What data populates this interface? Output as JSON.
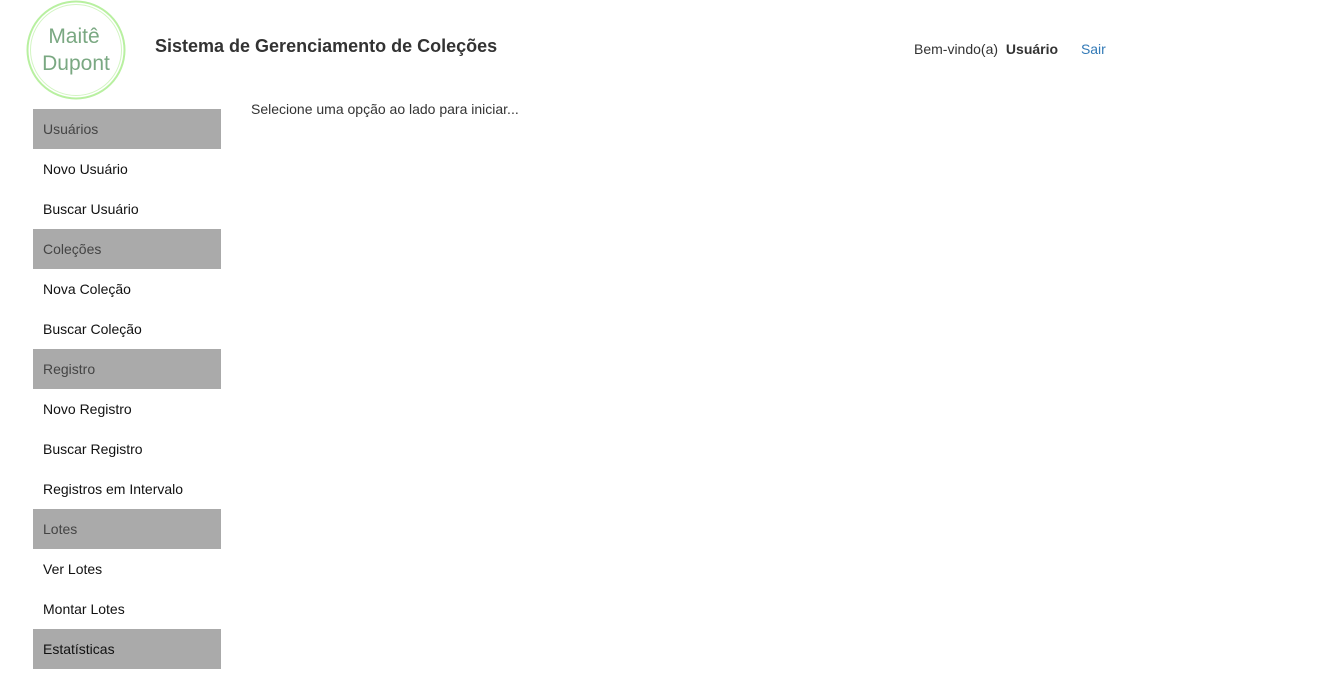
{
  "logo": {
    "line1": "Maitê",
    "line2": "Dupont",
    "ring_color": "#b8f0a0",
    "text_color": "#7aa882"
  },
  "header": {
    "title": "Sistema de Gerenciamento de Coleções",
    "welcome": "Bem-vindo(a)",
    "username": "Usuário",
    "logout": "Sair"
  },
  "sidebar": {
    "users": {
      "header": "Usuários",
      "new": "Novo Usuário",
      "search": "Buscar Usuário"
    },
    "collections": {
      "header": "Coleções",
      "new": "Nova Coleção",
      "search": "Buscar Coleção"
    },
    "records": {
      "header": "Registro",
      "new": "Novo Registro",
      "search": "Buscar Registro",
      "interval": "Registros em Intervalo"
    },
    "batches": {
      "header": "Lotes",
      "view": "Ver Lotes",
      "assemble": "Montar Lotes"
    },
    "stats": {
      "header": "Estatísticas"
    }
  },
  "main": {
    "message": "Selecione uma opção ao lado para iniciar..."
  },
  "colors": {
    "section_bg": "#aaaaaa",
    "link": "#337ab7"
  }
}
